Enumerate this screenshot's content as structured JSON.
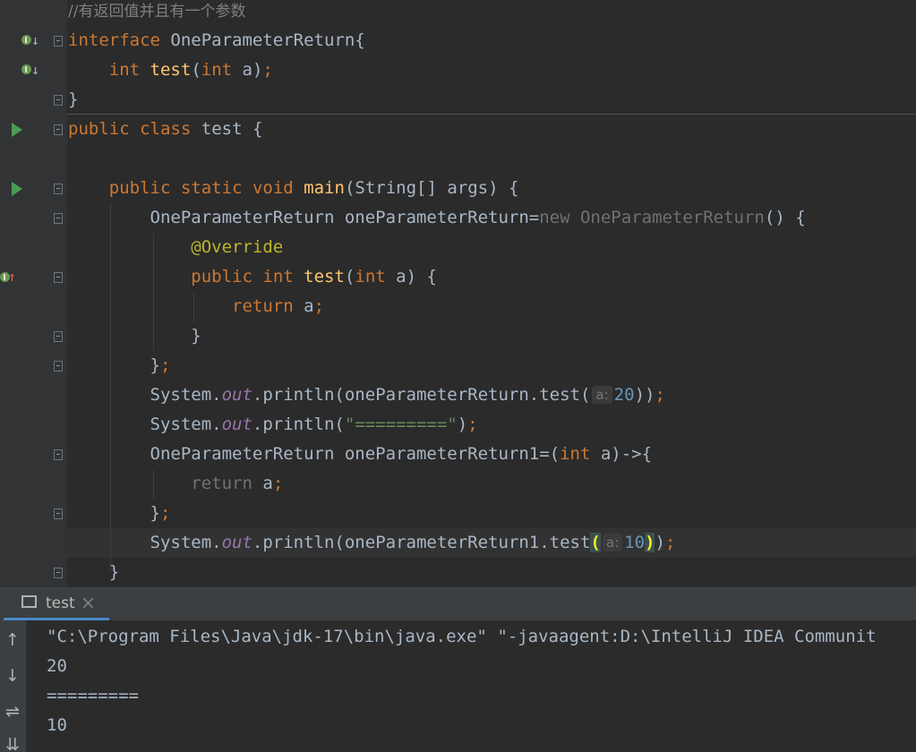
{
  "editor": {
    "comment": "//有返回值并且有一个参数",
    "line2": {
      "kw": "interface",
      "name": "OneParameterReturn{"
    },
    "line3": {
      "t1": "int",
      "fn": "test",
      "p1": "(",
      "t2": "int",
      "p2": " a)",
      "semi": ";"
    },
    "line4": "}",
    "line5": {
      "kw1": "public",
      "kw2": "class",
      "name": "test {"
    },
    "line7": {
      "kw1": "public",
      "kw2": "static",
      "kw3": "void",
      "fn": "main",
      "rest": "(String[] args) {"
    },
    "line8": {
      "a": "OneParameterReturn oneParameterReturn=",
      "kw": "new",
      "b": " OneParameterReturn",
      "c": "() {"
    },
    "line9": "@Override",
    "line10": {
      "kw1": "public",
      "kw2": "int",
      "fn": "test",
      "p1": "(",
      "kw3": "int",
      "rest": " a) {"
    },
    "line11": {
      "kw": "return",
      "rest": " a",
      "semi": ";"
    },
    "line12": "}",
    "line13": {
      "a": "}",
      "semi": ";"
    },
    "line14": {
      "a": "System.",
      "fld": "out",
      "b": ".println(oneParameterReturn.test(",
      "hint": "a:",
      "num": "20",
      "c": "))",
      "semi": ";"
    },
    "line15": {
      "a": "System.",
      "fld": "out",
      "b": ".println(",
      "str": "\"=========\"",
      "c": ")",
      "semi": ";"
    },
    "line16": {
      "a": "OneParameterReturn oneParameterReturn1=(",
      "kw": "int",
      "b": " a)->{"
    },
    "line17": {
      "kw": "return",
      "b": " a",
      "semi": ";"
    },
    "line18": {
      "a": "}",
      "semi": ";"
    },
    "line19": {
      "a": "System.",
      "fld": "out",
      "b": ".println(oneParameterReturn1.test",
      "lp": "(",
      "hint": "a:",
      "num": "10",
      "rp": ")",
      "c": ")",
      "semi": ";"
    },
    "line20": "}"
  },
  "run_panel": {
    "tab_label": "test",
    "tab_close": "×",
    "toolbar": {
      "up": "↑",
      "down": "↓",
      "wrap": "⇌",
      "scroll": "⇊"
    },
    "output": [
      "\"C:\\Program Files\\Java\\jdk-17\\bin\\java.exe\" \"-javaagent:D:\\IntelliJ IDEA Communit",
      "20",
      "=========",
      "10"
    ]
  },
  "colors": {
    "background": "#2b2b2b",
    "keyword": "#cc7832",
    "function": "#ffc66d",
    "string": "#6a8759",
    "number": "#6897bb",
    "annotation": "#bbb529",
    "field": "#9876aa"
  }
}
